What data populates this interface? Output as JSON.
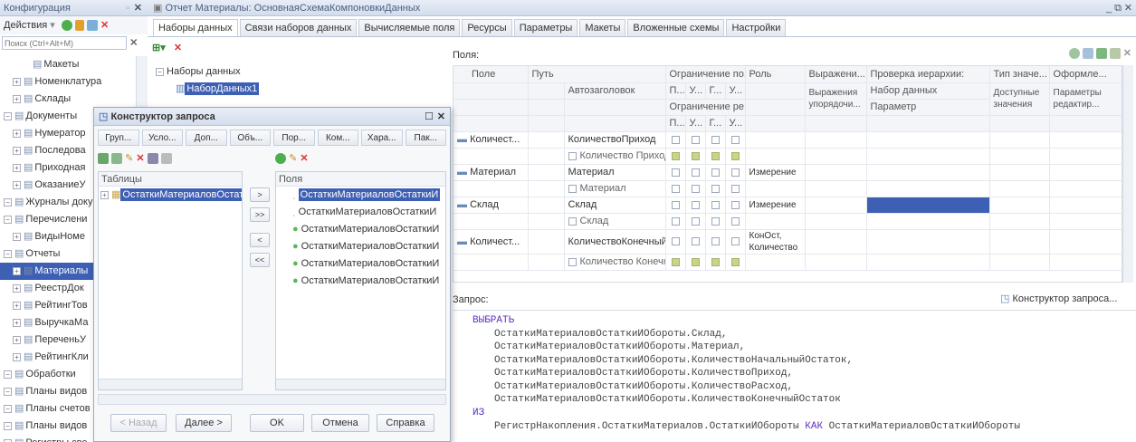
{
  "config_panel": {
    "title": "Конфигурация",
    "actions_label": "Действия",
    "search_placeholder": "Поиск (Ctrl+Alt+M)",
    "tree": [
      {
        "label": "Макеты",
        "indent": 2
      },
      {
        "label": "Номенклатура",
        "indent": 1
      },
      {
        "label": "Склады",
        "indent": 1
      },
      {
        "label": "Документы",
        "indent": 0
      },
      {
        "label": "Нумератор",
        "indent": 1
      },
      {
        "label": "Последова",
        "indent": 1
      },
      {
        "label": "Приходная",
        "indent": 1
      },
      {
        "label": "ОказаниеУ",
        "indent": 1
      },
      {
        "label": "Журналы доку",
        "indent": 0
      },
      {
        "label": "Перечислени",
        "indent": 0
      },
      {
        "label": "ВидыНоме",
        "indent": 1
      },
      {
        "label": "Отчеты",
        "indent": 0
      },
      {
        "label": "Материалы",
        "indent": 1
      },
      {
        "label": "РеестрДок",
        "indent": 1
      },
      {
        "label": "РейтингТов",
        "indent": 1
      },
      {
        "label": "ВыручкаМа",
        "indent": 1
      },
      {
        "label": "ПереченьУ",
        "indent": 1
      },
      {
        "label": "РейтингКли",
        "indent": 1
      },
      {
        "label": "Обработки",
        "indent": 0
      },
      {
        "label": "Планы видов",
        "indent": 0
      },
      {
        "label": "Планы счетов",
        "indent": 0
      },
      {
        "label": "Планы видов",
        "indent": 0
      },
      {
        "label": "Регистры све",
        "indent": 0
      }
    ]
  },
  "report": {
    "title": "Отчет Материалы: ОсновнаяСхемаКомпоновкиДанных",
    "tabs": [
      "Наборы данных",
      "Связи наборов данных",
      "Вычисляемые поля",
      "Ресурсы",
      "Параметры",
      "Макеты",
      "Вложенные схемы",
      "Настройки"
    ],
    "datasets_root": "Наборы данных",
    "dataset_item": "НаборДанных1",
    "fields_label": "Поля:",
    "grid_headers": {
      "field": "Поле",
      "path": "Путь",
      "restriction": "Ограничение по...",
      "role": "Роль",
      "expression": "Выражени...",
      "hier_check": "Проверка иерархии:",
      "value_type": "Тип значе...",
      "format": "Оформле...",
      "autotitle": "Автозаголовок",
      "p": "П...",
      "u": "У...",
      "g": "Г...",
      "u2": "У...",
      "restr2": "Ограничение ре...",
      "order_expr": "Выражения упорядочи...",
      "dataset": "Набор данных",
      "param": "Параметр",
      "avail_values": "Доступные значения",
      "edit_params": "Параметры редактир..."
    },
    "rows": [
      {
        "field": "Количест...",
        "path": "КоличествоПриход",
        "title": "Количество Приход",
        "role": "",
        "checked": true
      },
      {
        "field": "Материал",
        "path": "Материал",
        "title": "Материал",
        "role": "Измерение",
        "checked": false
      },
      {
        "field": "Склад",
        "path": "Склад",
        "title": "Склад",
        "role": "Измерение",
        "checked": false
      },
      {
        "field": "Количест...",
        "path": "КоличествоКонечныйОс...",
        "title": "Количество Конечн...",
        "role": "КонОст, Количество",
        "checked": true
      }
    ],
    "query_label": "Запрос:",
    "query_builder_link": "Конструктор запроса...",
    "query_lines": [
      {
        "text": "ВЫБРАТЬ",
        "kw": true,
        "indent": 0
      },
      {
        "text": "ОстаткиМатериаловОстаткиИОбороты.Склад,",
        "indent": 1
      },
      {
        "text": "ОстаткиМатериаловОстаткиИОбороты.Материал,",
        "indent": 1
      },
      {
        "text": "ОстаткиМатериаловОстаткиИОбороты.КоличествоНачальныйОстаток,",
        "indent": 1
      },
      {
        "text": "ОстаткиМатериаловОстаткиИОбороты.КоличествоПриход,",
        "indent": 1
      },
      {
        "text": "ОстаткиМатериаловОстаткиИОбороты.КоличествоРасход,",
        "indent": 1
      },
      {
        "text": "ОстаткиМатериаловОстаткиИОбороты.КоличествоКонечныйОстаток",
        "indent": 1
      },
      {
        "text": "ИЗ",
        "kw": true,
        "indent": 0
      }
    ],
    "query_from_a": "РегистрНакопления.ОстаткиМатериалов.ОстаткиИОбороты ",
    "query_from_kw": "КАК",
    "query_from_b": " ОстаткиМатериаловОстаткиИОбороты"
  },
  "dialog": {
    "title": "Конструктор запроса",
    "tabs": [
      "Груп...",
      "Усло...",
      "Доп...",
      "Объ...",
      "Пор...",
      "Ком...",
      "Хара...",
      "Пак..."
    ],
    "tables_label": "Таблицы",
    "fields_label": "Поля",
    "table_item": "ОстаткиМатериаловОстатк",
    "fields": [
      "ОстаткиМатериаловОстаткиИ",
      "ОстаткиМатериаловОстаткиИ",
      "ОстаткиМатериаловОстаткиИ",
      "ОстаткиМатериаловОстаткиИ",
      "ОстаткиМатериаловОстаткиИ",
      "ОстаткиМатериаловОстаткиИ"
    ],
    "move_buttons": [
      ">",
      ">>",
      "<",
      "<<"
    ],
    "back": "< Назад",
    "next": "Далее >",
    "ok": "OK",
    "cancel": "Отмена",
    "help": "Справка"
  }
}
